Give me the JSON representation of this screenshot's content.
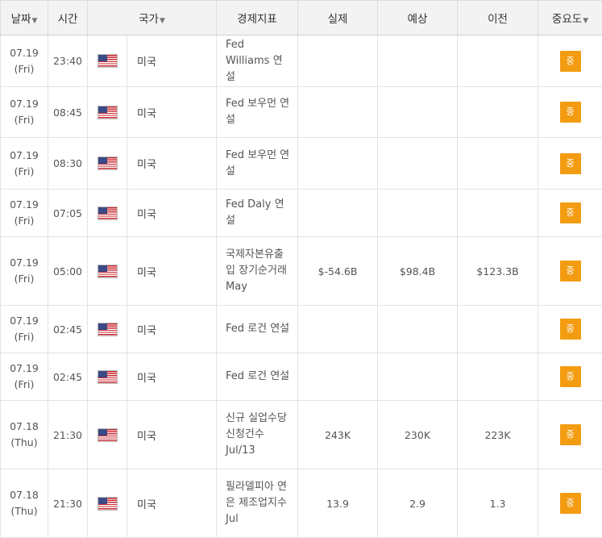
{
  "header": {
    "date": "날짜",
    "time": "시간",
    "country": "국가",
    "indicator": "경제지표",
    "actual": "실제",
    "forecast": "예상",
    "previous": "이전",
    "importance": "중요도",
    "sort_icon": "▼"
  },
  "colors": {
    "importance_badge": "#f39c12",
    "header_bg": "#f3f3f3"
  },
  "rows": [
    {
      "date": "07.19",
      "day": "(Fri)",
      "time": "23:40",
      "flag": "us-flag-icon",
      "country": "미국",
      "indicator": "Fed Williams 연설",
      "actual": "",
      "forecast": "",
      "previous": "",
      "importance": "중"
    },
    {
      "date": "07.19",
      "day": "(Fri)",
      "time": "08:45",
      "flag": "us-flag-icon",
      "country": "미국",
      "indicator": "Fed 보우먼 연설",
      "actual": "",
      "forecast": "",
      "previous": "",
      "importance": "중"
    },
    {
      "date": "07.19",
      "day": "(Fri)",
      "time": "08:30",
      "flag": "us-flag-icon",
      "country": "미국",
      "indicator": "Fed 보우먼 연설",
      "actual": "",
      "forecast": "",
      "previous": "",
      "importance": "중"
    },
    {
      "date": "07.19",
      "day": "(Fri)",
      "time": "07:05",
      "flag": "us-flag-icon",
      "country": "미국",
      "indicator": "Fed Daly 연설",
      "actual": "",
      "forecast": "",
      "previous": "",
      "importance": "중"
    },
    {
      "date": "07.19",
      "day": "(Fri)",
      "time": "05:00",
      "flag": "us-flag-icon",
      "country": "미국",
      "indicator": "국제자본유출입 장기순거래 May",
      "actual": "$-54.6B",
      "forecast": "$98.4B",
      "previous": "$123.3B",
      "importance": "중"
    },
    {
      "date": "07.19",
      "day": "(Fri)",
      "time": "02:45",
      "flag": "us-flag-icon",
      "country": "미국",
      "indicator": "Fed 로건 연설",
      "actual": "",
      "forecast": "",
      "previous": "",
      "importance": "중"
    },
    {
      "date": "07.19",
      "day": "(Fri)",
      "time": "02:45",
      "flag": "us-flag-icon",
      "country": "미국",
      "indicator": "Fed 로건 연설",
      "actual": "",
      "forecast": "",
      "previous": "",
      "importance": "중"
    },
    {
      "date": "07.18",
      "day": "(Thu)",
      "time": "21:30",
      "flag": "us-flag-icon",
      "country": "미국",
      "indicator": "신규 실업수당 신청건수 Jul/13",
      "actual": "243K",
      "forecast": "230K",
      "previous": "223K",
      "importance": "중"
    },
    {
      "date": "07.18",
      "day": "(Thu)",
      "time": "21:30",
      "flag": "us-flag-icon",
      "country": "미국",
      "indicator": "필라델피아 연은 제조업지수 Jul",
      "actual": "13.9",
      "forecast": "2.9",
      "previous": "1.3",
      "importance": "중"
    }
  ]
}
